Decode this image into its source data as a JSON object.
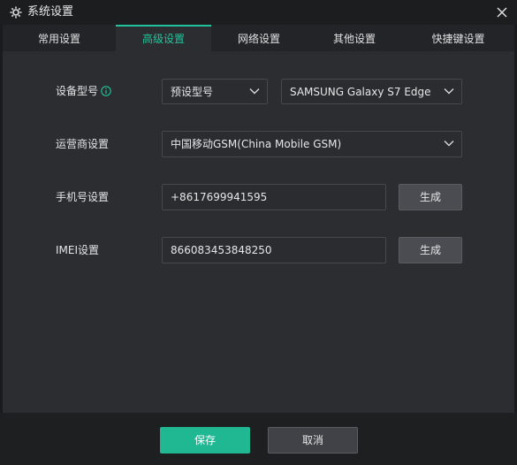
{
  "window": {
    "title": "系统设置",
    "icon": "gear-icon",
    "close_icon": "close-icon"
  },
  "tabs": [
    {
      "label": "常用设置",
      "active": false
    },
    {
      "label": "高级设置",
      "active": true
    },
    {
      "label": "网络设置",
      "active": false
    },
    {
      "label": "其他设置",
      "active": false
    },
    {
      "label": "快捷键设置",
      "active": false
    }
  ],
  "settings": {
    "device_model": {
      "label": "设备型号",
      "info_icon": "info-icon",
      "preset_select": "预设型号",
      "model_select": "SAMSUNG Galaxy S7 Edge"
    },
    "carrier": {
      "label": "运营商设置",
      "select": "中国移动GSM(China Mobile GSM)"
    },
    "phone": {
      "label": "手机号设置",
      "value": "+8617699941595",
      "generate": "生成"
    },
    "imei": {
      "label": "IMEI设置",
      "value": "866083453848250",
      "generate": "生成"
    }
  },
  "footer": {
    "save": "保存",
    "cancel": "取消"
  },
  "colors": {
    "accent": "#20c49c",
    "background": "#2c2d31",
    "titlebar": "#1c1d1f"
  }
}
